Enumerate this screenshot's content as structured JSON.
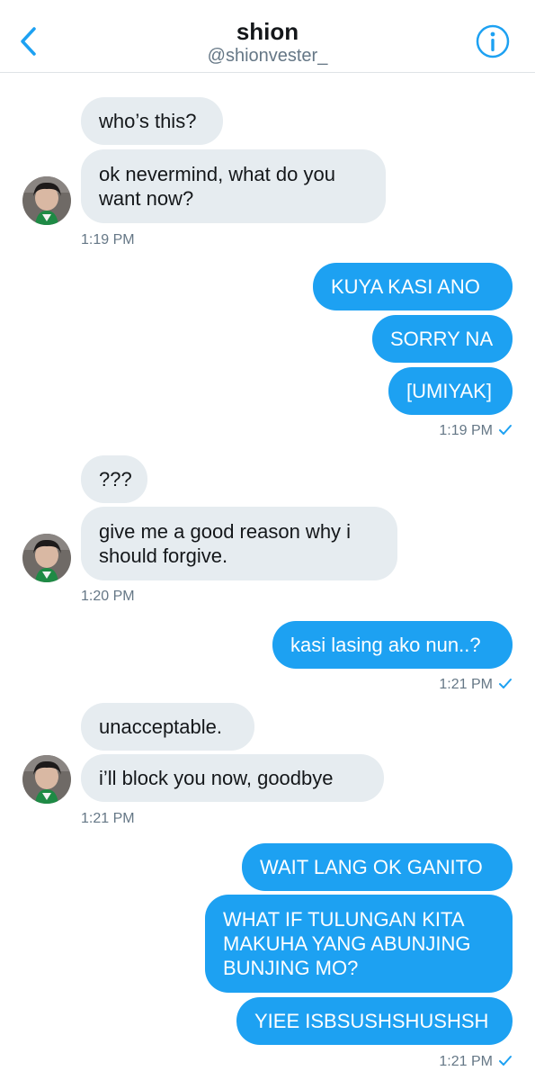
{
  "header": {
    "title": "shion",
    "handle": "@shionvester_",
    "back_icon": "chevron-left-icon",
    "info_icon": "info-icon",
    "accent_color": "#1da1f2"
  },
  "colors": {
    "incoming_bubble": "#e6ecf0",
    "outgoing_bubble": "#1da1f2",
    "timestamp": "#657786"
  },
  "messages": [
    {
      "from": "them",
      "text": "who’s this?"
    },
    {
      "from": "them",
      "text": "ok nevermind, what do you\nwant now?"
    },
    {
      "from": "me",
      "text": "KUYA KASI ANO"
    },
    {
      "from": "me",
      "text": "SORRY NA"
    },
    {
      "from": "me",
      "text": "[UMIYAK]"
    },
    {
      "from": "them",
      "text": "???"
    },
    {
      "from": "them",
      "text": "give me a good reason why i\nshould forgive."
    },
    {
      "from": "me",
      "text": "kasi lasing ako nun..?"
    },
    {
      "from": "them",
      "text": "unacceptable."
    },
    {
      "from": "them",
      "text": "i’ll block you now, goodbye"
    },
    {
      "from": "me",
      "text": "WAIT LANG OK GANITO"
    },
    {
      "from": "me",
      "text": "WHAT IF TULUNGAN KITA\nMAKUHA YANG ABUNJING\nBUNJING MO?"
    },
    {
      "from": "me",
      "text": "YIEE ISBSUSHSHUSHSH"
    }
  ],
  "timestamps": [
    {
      "text": "1:19 PM",
      "side": "left"
    },
    {
      "text": "1:19 PM",
      "side": "right",
      "read": true
    },
    {
      "text": "1:20 PM",
      "side": "left"
    },
    {
      "text": "1:21 PM",
      "side": "right",
      "read": true
    },
    {
      "text": "1:21 PM",
      "side": "left"
    },
    {
      "text": "1:21 PM",
      "side": "right",
      "read": true
    }
  ]
}
